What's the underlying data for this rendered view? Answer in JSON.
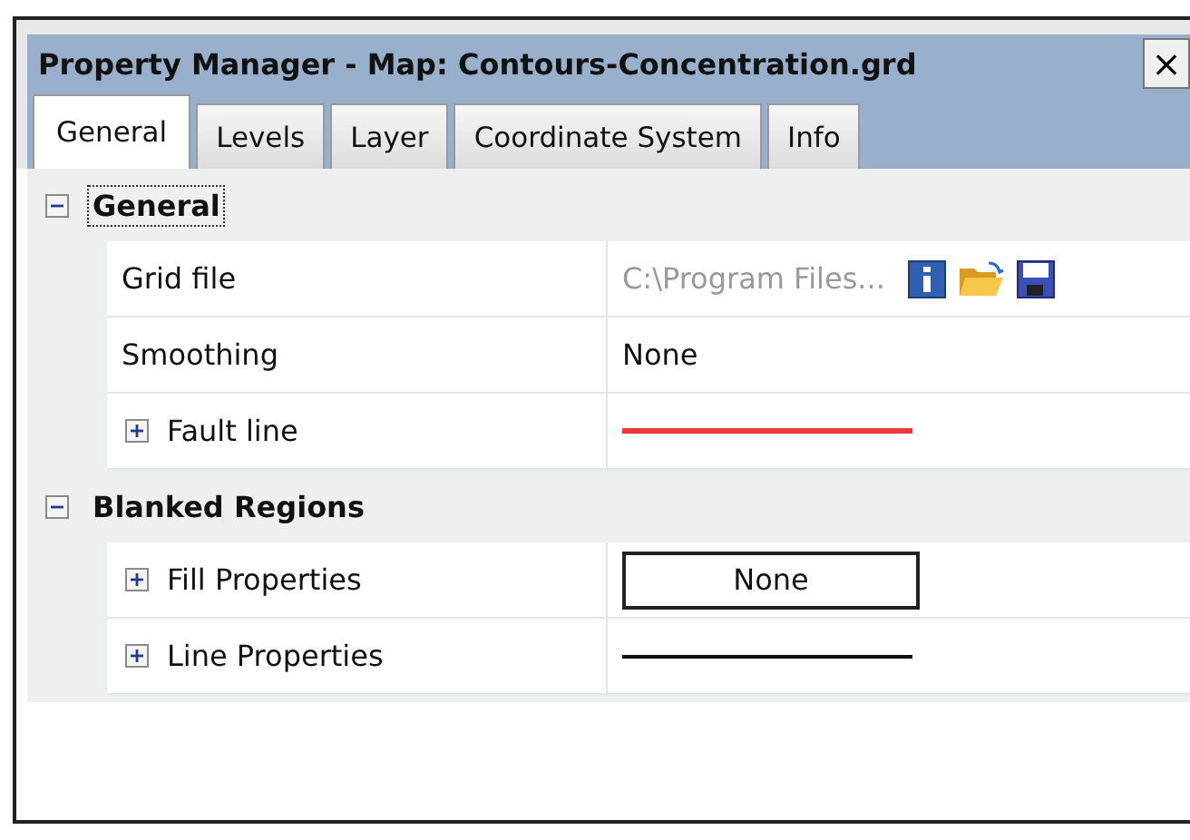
{
  "window": {
    "title": "Property Manager - Map: Contours-Concentration.grd",
    "close": "×"
  },
  "tabs": [
    {
      "label": "General",
      "selected": true
    },
    {
      "label": "Levels",
      "selected": false
    },
    {
      "label": "Layer",
      "selected": false
    },
    {
      "label": "Coordinate System",
      "selected": false
    },
    {
      "label": "Info",
      "selected": false
    }
  ],
  "groups": [
    {
      "name": "General",
      "expanded": true,
      "focused": true,
      "rows": [
        {
          "label": "Grid file",
          "kind": "file",
          "value": "C:\\Program Files...",
          "expandable": false
        },
        {
          "label": "Smoothing",
          "kind": "text",
          "value": "None",
          "expandable": false
        },
        {
          "label": "Fault line",
          "kind": "line",
          "color": "#e83a3a",
          "expandable": true,
          "expanded": false
        }
      ]
    },
    {
      "name": "Blanked Regions",
      "expanded": true,
      "focused": false,
      "rows": [
        {
          "label": "Fill Properties",
          "kind": "fill",
          "value": "None",
          "expandable": true,
          "expanded": false
        },
        {
          "label": "Line Properties",
          "kind": "line",
          "color": "#111111",
          "expandable": true,
          "expanded": false
        }
      ]
    }
  ]
}
